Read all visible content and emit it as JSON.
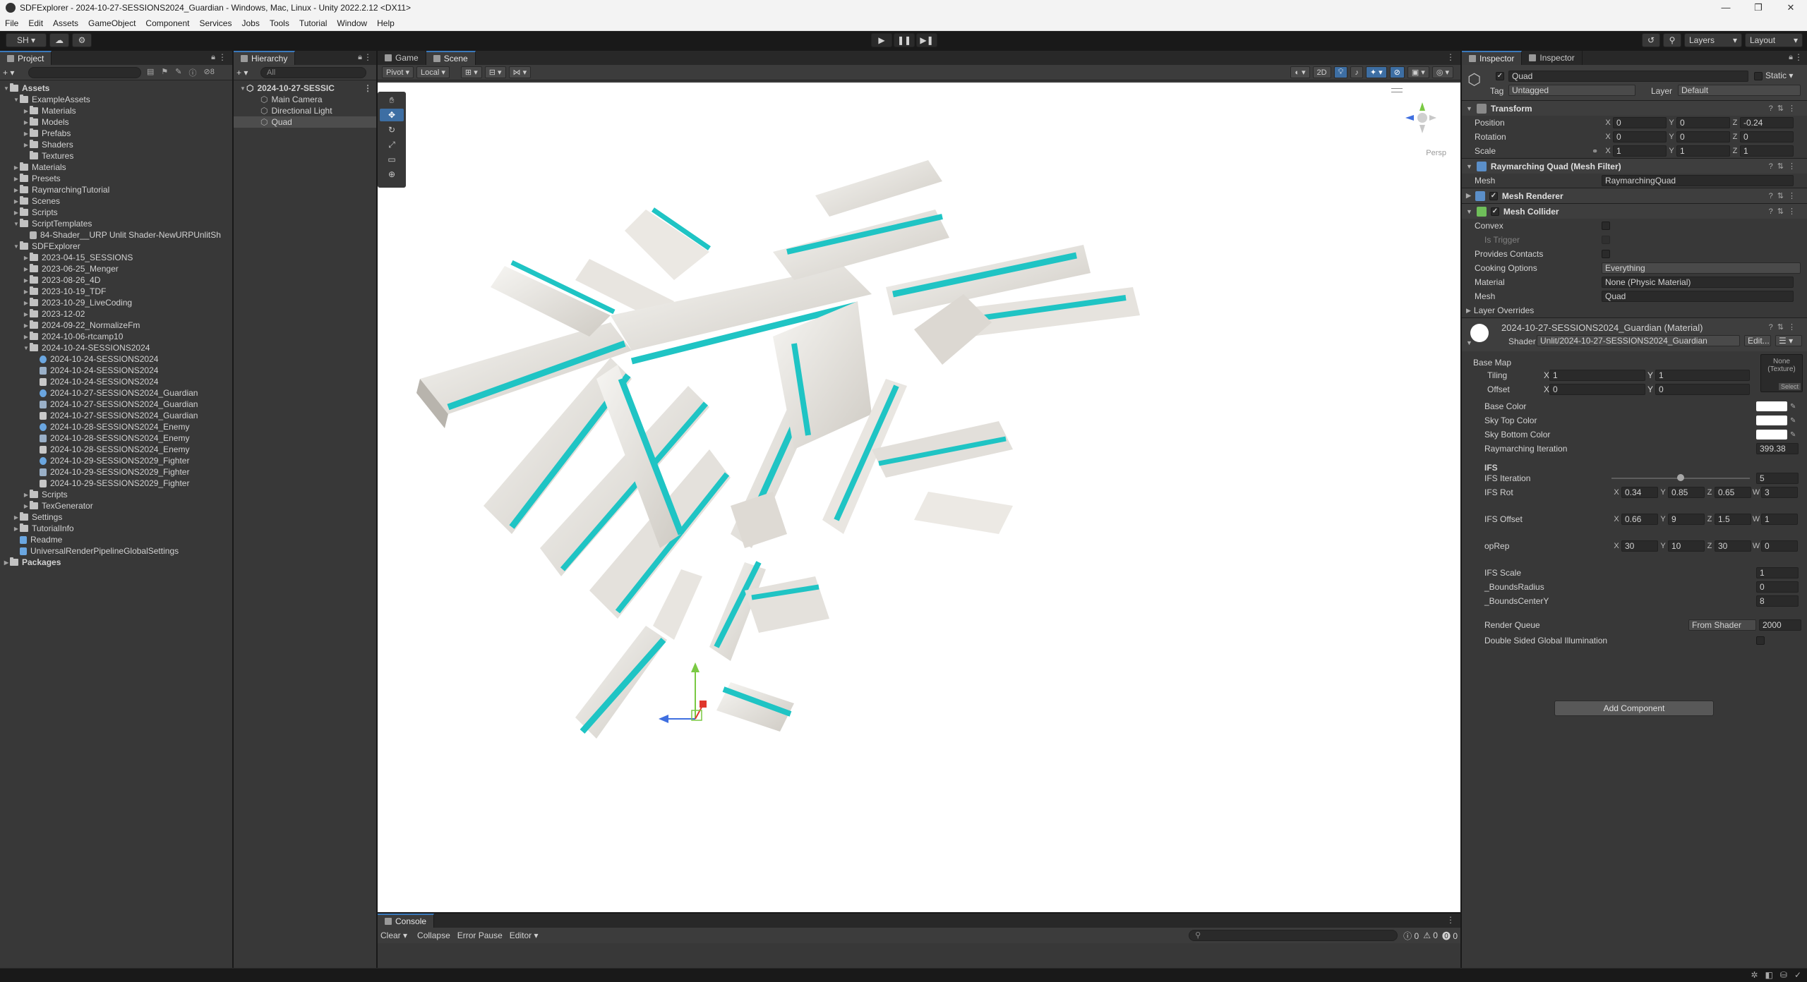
{
  "window": {
    "title": "SDFExplorer - 2024-10-27-SESSIONS2024_Guardian - Windows, Mac, Linux - Unity 2022.2.12 <DX11>",
    "controls": [
      "—",
      "❐",
      "✕"
    ]
  },
  "menu": [
    "File",
    "Edit",
    "Assets",
    "GameObject",
    "Component",
    "Services",
    "Jobs",
    "Tools",
    "Tutorial",
    "Window",
    "Help"
  ],
  "toolbar": {
    "account": "SH ▾",
    "cloud": "☁",
    "collab": "⚙",
    "play": "▶",
    "pause": "❚❚",
    "step": "▶❚",
    "history": "↺",
    "search": "⚲",
    "layers": "Layers",
    "layout": "Layout"
  },
  "project": {
    "tab": "Project",
    "add": "+ ▾",
    "search_placeholder": "",
    "hidden_count": "8",
    "tree": [
      {
        "indent": 0,
        "label": "Assets",
        "type": "folder",
        "open": true,
        "bold": true
      },
      {
        "indent": 1,
        "label": "ExampleAssets",
        "type": "folder",
        "open": true
      },
      {
        "indent": 2,
        "label": "Materials",
        "type": "folder"
      },
      {
        "indent": 2,
        "label": "Models",
        "type": "folder"
      },
      {
        "indent": 2,
        "label": "Prefabs",
        "type": "folder"
      },
      {
        "indent": 2,
        "label": "Shaders",
        "type": "folder"
      },
      {
        "indent": 2,
        "label": "Textures",
        "type": "folder",
        "noarrow": true
      },
      {
        "indent": 1,
        "label": "Materials",
        "type": "folder"
      },
      {
        "indent": 1,
        "label": "Presets",
        "type": "folder"
      },
      {
        "indent": 1,
        "label": "RaymarchingTutorial",
        "type": "folder"
      },
      {
        "indent": 1,
        "label": "Scenes",
        "type": "folder"
      },
      {
        "indent": 1,
        "label": "Scripts",
        "type": "folder"
      },
      {
        "indent": 1,
        "label": "ScriptTemplates",
        "type": "folder",
        "open": true
      },
      {
        "indent": 2,
        "label": "84-Shader__URP Unlit Shader-NewURPUnlitSh",
        "type": "file",
        "noarrow": true
      },
      {
        "indent": 1,
        "label": "SDFExplorer",
        "type": "folder",
        "open": true
      },
      {
        "indent": 2,
        "label": "2023-04-15_SESSIONS",
        "type": "folder"
      },
      {
        "indent": 2,
        "label": "2023-06-25_Menger",
        "type": "folder"
      },
      {
        "indent": 2,
        "label": "2023-08-26_4D",
        "type": "folder"
      },
      {
        "indent": 2,
        "label": "2023-10-19_TDF",
        "type": "folder"
      },
      {
        "indent": 2,
        "label": "2023-10-29_LiveCoding",
        "type": "folder"
      },
      {
        "indent": 2,
        "label": "2023-12-02",
        "type": "folder"
      },
      {
        "indent": 2,
        "label": "2024-09-22_NormalizeFm",
        "type": "folder"
      },
      {
        "indent": 2,
        "label": "2024-10-06-rtcamp10",
        "type": "folder"
      },
      {
        "indent": 2,
        "label": "2024-10-24-SESSIONS2024",
        "type": "folder",
        "open": true
      },
      {
        "indent": 3,
        "label": "2024-10-24-SESSIONS2024",
        "type": "material",
        "noarrow": true
      },
      {
        "indent": 3,
        "label": "2024-10-24-SESSIONS2024",
        "type": "shader",
        "noarrow": true
      },
      {
        "indent": 3,
        "label": "2024-10-24-SESSIONS2024",
        "type": "scene",
        "noarrow": true
      },
      {
        "indent": 3,
        "label": "2024-10-27-SESSIONS2024_Guardian",
        "type": "material",
        "noarrow": true
      },
      {
        "indent": 3,
        "label": "2024-10-27-SESSIONS2024_Guardian",
        "type": "shader",
        "noarrow": true
      },
      {
        "indent": 3,
        "label": "2024-10-27-SESSIONS2024_Guardian",
        "type": "scene",
        "noarrow": true
      },
      {
        "indent": 3,
        "label": "2024-10-28-SESSIONS2024_Enemy",
        "type": "material",
        "noarrow": true
      },
      {
        "indent": 3,
        "label": "2024-10-28-SESSIONS2024_Enemy",
        "type": "shader",
        "noarrow": true
      },
      {
        "indent": 3,
        "label": "2024-10-28-SESSIONS2024_Enemy",
        "type": "scene",
        "noarrow": true
      },
      {
        "indent": 3,
        "label": "2024-10-29-SESSIONS2029_Fighter",
        "type": "material",
        "noarrow": true
      },
      {
        "indent": 3,
        "label": "2024-10-29-SESSIONS2029_Fighter",
        "type": "shader",
        "noarrow": true
      },
      {
        "indent": 3,
        "label": "2024-10-29-SESSIONS2029_Fighter",
        "type": "scene",
        "noarrow": true
      },
      {
        "indent": 2,
        "label": "Scripts",
        "type": "folder"
      },
      {
        "indent": 2,
        "label": "TexGenerator",
        "type": "folder"
      },
      {
        "indent": 1,
        "label": "Settings",
        "type": "folder"
      },
      {
        "indent": 1,
        "label": "TutorialInfo",
        "type": "folder"
      },
      {
        "indent": 1,
        "label": "Readme",
        "type": "readme",
        "noarrow": true
      },
      {
        "indent": 1,
        "label": "UniversalRenderPipelineGlobalSettings",
        "type": "settings",
        "noarrow": true
      },
      {
        "indent": 0,
        "label": "Packages",
        "type": "folder",
        "bold": true
      }
    ]
  },
  "hierarchy": {
    "tab": "Hierarchy",
    "add": "+ ▾",
    "search_placeholder": "All",
    "root": "2024-10-27-SESSIC",
    "items": [
      "Main Camera",
      "Directional Light",
      "Quad"
    ]
  },
  "scene": {
    "tabs": [
      "Game",
      "Scene"
    ],
    "pivot": "Pivot ▾",
    "local": "Local ▾",
    "mode2d": "2D",
    "persp": "Persp"
  },
  "console": {
    "tab": "Console",
    "buttons": [
      "Clear ▾",
      "Collapse",
      "Error Pause",
      "Editor ▾"
    ],
    "counts": [
      "0",
      "0",
      "0"
    ]
  },
  "inspector": {
    "tabs": [
      "Inspector",
      "Inspector"
    ],
    "object_name": "Quad",
    "static_label": "Static",
    "tag_label": "Tag",
    "tag_value": "Untagged",
    "layer_label": "Layer",
    "layer_value": "Default",
    "transform": {
      "title": "Transform",
      "position_label": "Position",
      "position": [
        "0",
        "0",
        "-0.24"
      ],
      "rotation_label": "Rotation",
      "rotation": [
        "0",
        "0",
        "0"
      ],
      "scale_label": "Scale",
      "scale": [
        "1",
        "1",
        "1"
      ]
    },
    "mesh_filter": {
      "title": "Raymarching Quad (Mesh Filter)",
      "mesh_label": "Mesh",
      "mesh_value": "RaymarchingQuad"
    },
    "mesh_renderer": {
      "title": "Mesh Renderer"
    },
    "mesh_collider": {
      "title": "Mesh Collider",
      "convex": "Convex",
      "is_trigger": "Is Trigger",
      "provides_contacts": "Provides Contacts",
      "cooking_label": "Cooking Options",
      "cooking_value": "Everything",
      "material_label": "Material",
      "material_value": "None (Physic Material)",
      "mesh_label": "Mesh",
      "mesh_value": "Quad",
      "layer_overrides": "Layer Overrides"
    },
    "material": {
      "title": "2024-10-27-SESSIONS2024_Guardian (Material)",
      "shader_label": "Shader",
      "shader_value": "Unlit/2024-10-27-SESSIONS2024_Guardian",
      "edit": "Edit...",
      "base_map": "Base Map",
      "texture_slot": "None (Texture)",
      "select": "Select",
      "tiling_label": "Tiling",
      "tiling": [
        "1",
        "1"
      ],
      "offset_label": "Offset",
      "offset": [
        "0",
        "0"
      ],
      "base_color": "Base Color",
      "sky_top": "Sky Top Color",
      "sky_bottom": "Sky Bottom Color",
      "ray_iter_label": "Raymarching Iteration",
      "ray_iter_value": "399.38",
      "ifs_header": "IFS",
      "ifs_iter_label": "IFS Iteration",
      "ifs_iter_value": "5",
      "ifs_iter_fraction": 0.5,
      "ifs_rot_label": "IFS Rot",
      "ifs_rot": [
        "0.34",
        "0.85",
        "0.65",
        "3"
      ],
      "ifs_offset_label": "IFS Offset",
      "ifs_offset": [
        "0.66",
        "9",
        "1.5",
        "1"
      ],
      "oprep_label": "opRep",
      "oprep": [
        "30",
        "10",
        "30",
        "0"
      ],
      "ifs_scale_label": "IFS Scale",
      "ifs_scale": "1",
      "bounds_radius_label": "_BoundsRadius",
      "bounds_radius": "0",
      "bounds_centery_label": "_BoundsCenterY",
      "bounds_centery": "8",
      "render_queue_label": "Render Queue",
      "render_queue_mode": "From Shader",
      "render_queue_value": "2000",
      "double_sided": "Double Sided Global Illumination"
    },
    "add_component": "Add Component"
  },
  "colors": {
    "accent": "#3a79bb",
    "teal": "#1fc4c4",
    "panel": "#383838"
  }
}
